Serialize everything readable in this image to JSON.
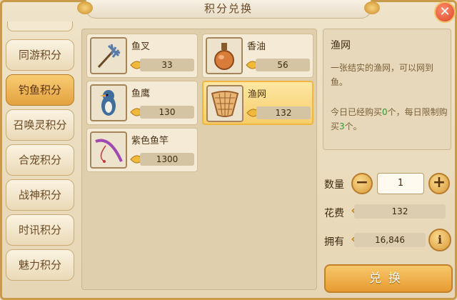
{
  "window": {
    "title": "积分兑换",
    "close_label": "✕"
  },
  "tabs": [
    {
      "label": "同游积分",
      "active": false
    },
    {
      "label": "钓鱼积分",
      "active": true
    },
    {
      "label": "召唤灵积分",
      "active": false
    },
    {
      "label": "合宠积分",
      "active": false
    },
    {
      "label": "战神积分",
      "active": false
    },
    {
      "label": "时讯积分",
      "active": false
    },
    {
      "label": "魅力积分",
      "active": false
    }
  ],
  "items": [
    {
      "name": "鱼叉",
      "price": "33",
      "icon": "trident-icon"
    },
    {
      "name": "香油",
      "price": "56",
      "icon": "oil-bottle-icon"
    },
    {
      "name": "鱼鹰",
      "price": "130",
      "icon": "kingfisher-icon"
    },
    {
      "name": "渔网",
      "price": "132",
      "icon": "fishing-net-icon",
      "selected": true
    },
    {
      "name": "紫色鱼竿",
      "price": "1300",
      "icon": "fishing-rod-icon"
    }
  ],
  "detail": {
    "name": "渔网",
    "description": "一张结实的渔网，可以网到鱼。",
    "limit_prefix": "今日已经购买",
    "bought": "0",
    "limit_middle": "个，每日限制购买",
    "limit": "3",
    "limit_suffix": "个。"
  },
  "purchase": {
    "quantity_label": "数量",
    "quantity": "1",
    "minus_label": "−",
    "plus_label": "+",
    "cost_label": "花费",
    "cost": "132",
    "owned_label": "拥有",
    "owned": "16,846",
    "info_label": "i",
    "exchange_label": "兑换"
  },
  "colors": {
    "accent": "#e69a32",
    "highlight_green": "#2f9a2f",
    "selected_bg": "#f6cd6a"
  }
}
